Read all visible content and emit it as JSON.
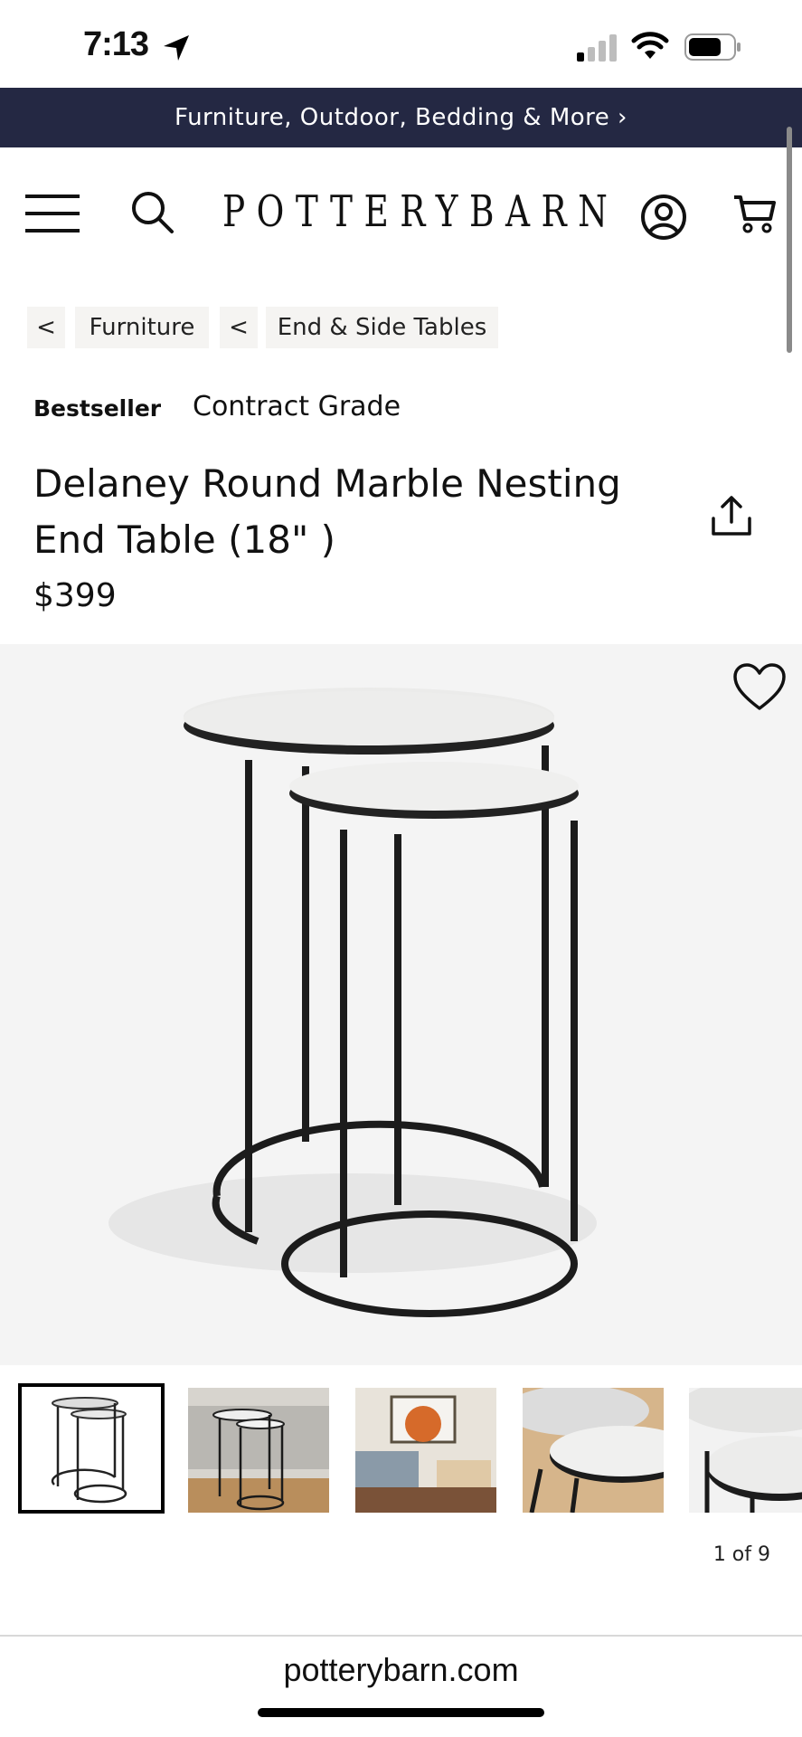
{
  "status_bar": {
    "time": "7:13"
  },
  "promo_banner": {
    "text": "Furniture, Outdoor, Bedding & More ›"
  },
  "header": {
    "brand": "POTTERYBARN",
    "icons": [
      "hamburger-menu-icon",
      "search-icon",
      "account-icon",
      "cart-icon"
    ]
  },
  "breadcrumbs": {
    "back_1": "<",
    "item_1": "Furniture",
    "back_2": "<",
    "item_2": "End & Side Tables"
  },
  "badges": {
    "bestseller": "Bestseller",
    "contract": "Contract Grade"
  },
  "product": {
    "title": "Delaney Round Marble Nesting End Table (18\" )",
    "price": "$399"
  },
  "gallery": {
    "counter": "1 of 9",
    "selected_index": 1,
    "total": 9
  },
  "browser": {
    "url": "potterybarn.com"
  },
  "colors": {
    "banner": "#242843",
    "hero_bg": "#f4f4f4",
    "crumb_bg": "#f5f4f2"
  }
}
